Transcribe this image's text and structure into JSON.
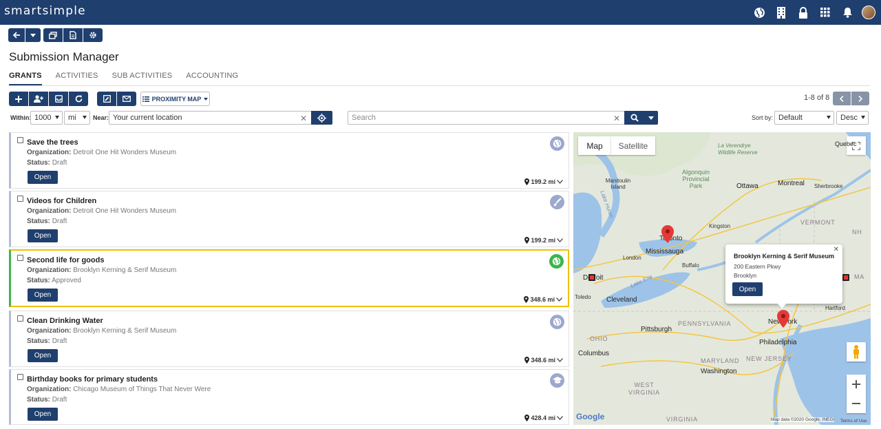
{
  "app": {
    "logo": "smartsimple"
  },
  "page": {
    "title": "Submission Manager"
  },
  "tabs": [
    {
      "label": "GRANTS",
      "active": true
    },
    {
      "label": "ACTIVITIES",
      "active": false
    },
    {
      "label": "SUB ACTIVITIES",
      "active": false
    },
    {
      "label": "ACCOUNTING",
      "active": false
    }
  ],
  "toolbar": {
    "view_label": "PROXIMITY MAP"
  },
  "pager": {
    "text": "1-8 of 8"
  },
  "filters": {
    "within_label": "Within:",
    "within_value": "1000",
    "unit_value": "mi",
    "near_label": "Near:",
    "near_value": "Your current location",
    "search_placeholder": "Search",
    "sort_label": "Sort by:",
    "sort_value": "Default",
    "order_value": "Desc"
  },
  "labels": {
    "organization": "Organization:",
    "status": "Status:",
    "open": "Open"
  },
  "records": [
    {
      "title": "Save the trees",
      "organization": "Detroit One Hit Wonders Museum",
      "status": "Draft",
      "distance": "199.2 mi",
      "icon": "globe-icon"
    },
    {
      "title": "Videos for Children",
      "organization": "Detroit One Hit Wonders Museum",
      "status": "Draft",
      "distance": "199.2 mi",
      "icon": "brush-icon"
    },
    {
      "title": "Second life for goods",
      "organization": "Brooklyn Kerning & Serif Museum",
      "status": "Approved",
      "distance": "348.6 mi",
      "icon": "globe-icon",
      "selected": true
    },
    {
      "title": "Clean Drinking Water",
      "organization": "Brooklyn Kerning & Serif Museum",
      "status": "Draft",
      "distance": "348.6 mi",
      "icon": "globe-icon"
    },
    {
      "title": "Birthday books for primary students",
      "organization": "Chicago Museum of Things That Never Were",
      "status": "Draft",
      "distance": "428.4 mi",
      "icon": "graduation-cap-icon"
    }
  ],
  "map": {
    "map_tab": "Map",
    "satellite_tab": "Satellite",
    "attribution": "Map data ©2020 Google, INEGI",
    "terms": "Terms of Use",
    "google": "Google",
    "popup": {
      "title": "Brooklyn Kerning & Serif Museum",
      "address": "200 Eastern Pkwy",
      "city": "Brooklyn",
      "open": "Open"
    },
    "places": [
      "Quebec",
      "La Verendrye Wildlife Reserve",
      "Algonquin Provincial Park",
      "Manitoulin Island",
      "Ottawa",
      "Montreal",
      "Sherbrooke",
      "Lake Huron",
      "Kingston",
      "VERMONT",
      "Toronto",
      "Mississauga",
      "Buffalo",
      "London",
      "Detroit",
      "Lake Erie",
      "Toledo",
      "Cleveland",
      "New York",
      "PENNSYLVANIA",
      "Pittsburgh",
      "OHIO",
      "Columbus",
      "Philadelphia",
      "MARYLAND",
      "NEW JERSEY",
      "Washington",
      "WEST VIRGINIA",
      "VIRGINIA",
      "NH",
      "MA",
      "Hartford"
    ]
  },
  "colors": {
    "primary": "#1f3f6e",
    "selected_border": "#f0c000",
    "approved": "#3cb44b",
    "badge": "#9ca8cc",
    "marker": "#e53935"
  }
}
